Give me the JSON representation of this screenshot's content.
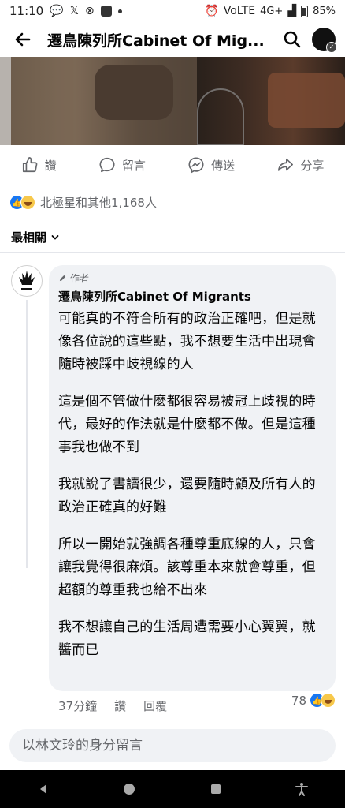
{
  "status_bar": {
    "time": "11:10",
    "network": "4G+",
    "battery": "85%"
  },
  "header": {
    "title": "遷鳥陳列所Cabinet Of Mig..."
  },
  "post_actions": {
    "like": "讚",
    "comment": "留言",
    "share_send": "傳送",
    "share": "分享"
  },
  "reactions": {
    "summary": "北極星和其他1,168人"
  },
  "sort": {
    "label": "最相關"
  },
  "comment": {
    "badge": "作者",
    "author": "遷鳥陳列所Cabinet Of Migrants",
    "paragraphs": [
      "可能真的不符合所有的政治正確吧，但是就像各位說的這些點，我不想要生活中出現會隨時被踩中歧視線的人",
      "這是個不管做什麼都很容易被冠上歧視的時代，最好的作法就是什麼都不做。但是這種事我也做不到",
      "我就說了書讀很少，還要隨時顧及所有人的政治正確真的好難",
      "所以一開始就強調各種尊重底線的人，只會讓我覺得很麻煩。該尊重本來就會尊重，但超額的尊重我也給不出來",
      "我不想讓自己的生活周遭需要小心翼翼，就醬而已"
    ],
    "time": "37分鐘",
    "like_label": "讚",
    "reply_label": "回覆",
    "reaction_count": "78"
  },
  "composer": {
    "placeholder": "以林文玲的身分留言"
  },
  "colors": {
    "accent": "#1877f2",
    "muted_text": "#65676b",
    "bubble_bg": "#f0f2f5"
  },
  "icons": [
    "back-arrow-icon",
    "search-icon",
    "thumbs-up-icon",
    "comment-icon",
    "messenger-icon",
    "share-icon",
    "chevron-down-icon",
    "pencil-icon",
    "nav-back-icon",
    "nav-home-icon",
    "nav-recents-icon",
    "accessibility-icon"
  ]
}
